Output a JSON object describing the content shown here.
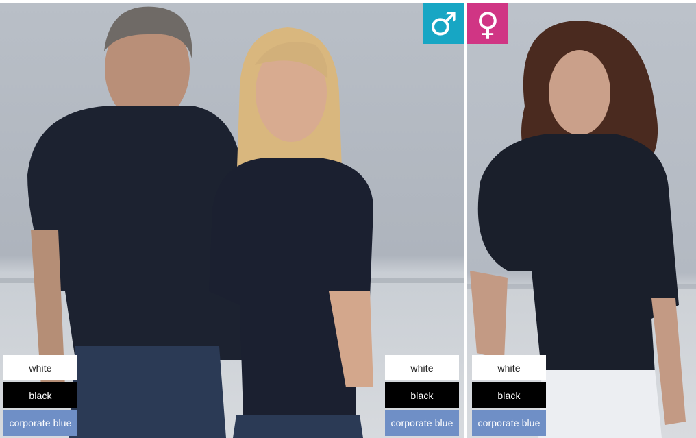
{
  "gender_badges": {
    "male": {
      "glyph": "♂",
      "color": "#17a6c4"
    },
    "female": {
      "glyph": "♀",
      "color": "#d03584"
    }
  },
  "colors": {
    "white": "#ffffff",
    "black": "#000000",
    "corporate_blue": "#6f8fc6"
  },
  "swatch_groups": [
    {
      "items": [
        "white",
        "black",
        "corporate blue"
      ]
    },
    {
      "items": [
        "white",
        "black",
        "corporate blue"
      ]
    },
    {
      "items": [
        "white",
        "black",
        "corporate blue"
      ]
    }
  ]
}
